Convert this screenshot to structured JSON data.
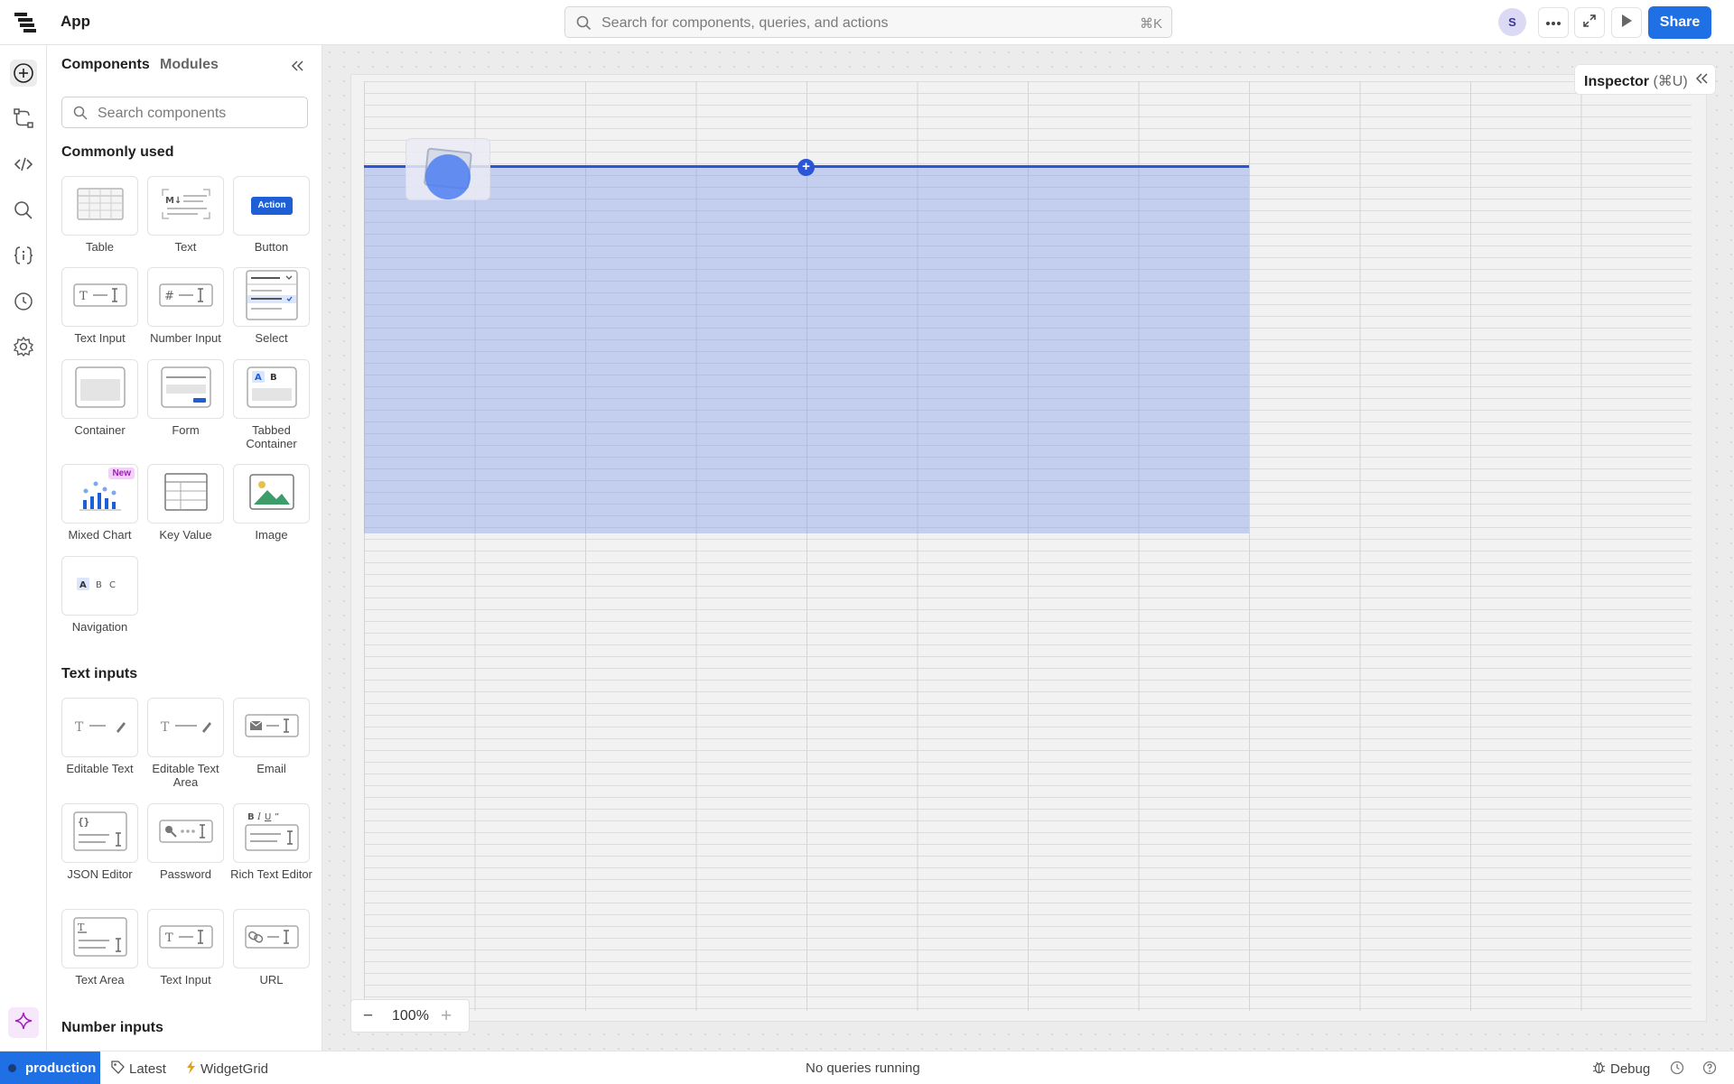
{
  "app": {
    "title": "App"
  },
  "search": {
    "placeholder": "Search for components, queries, and actions",
    "shortcut": "⌘K"
  },
  "user": {
    "initial": "S"
  },
  "toolbar": {
    "share_label": "Share"
  },
  "panel": {
    "tabs": [
      {
        "label": "Components"
      },
      {
        "label": "Modules"
      }
    ],
    "search_placeholder": "Search components",
    "sections": [
      {
        "title": "Commonly used",
        "items": [
          {
            "label": "Table"
          },
          {
            "label": "Text"
          },
          {
            "label": "Button",
            "thumb_text": "Action"
          },
          {
            "label": "Text Input"
          },
          {
            "label": "Number Input"
          },
          {
            "label": "Select"
          },
          {
            "label": "Container"
          },
          {
            "label": "Form"
          },
          {
            "label": "Tabbed Container"
          },
          {
            "label": "Mixed Chart",
            "badge": "New"
          },
          {
            "label": "Key Value"
          },
          {
            "label": "Image"
          },
          {
            "label": "Navigation"
          }
        ]
      },
      {
        "title": "Text inputs",
        "items": [
          {
            "label": "Editable Text"
          },
          {
            "label": "Editable Text Area"
          },
          {
            "label": "Email"
          },
          {
            "label": "JSON Editor"
          },
          {
            "label": "Password"
          },
          {
            "label": "Rich Text Editor"
          },
          {
            "label": "Text Area"
          },
          {
            "label": "Text Input"
          },
          {
            "label": "URL"
          }
        ]
      },
      {
        "title": "Number inputs",
        "items": []
      }
    ]
  },
  "inspector": {
    "label": "Inspector",
    "shortcut": "(⌘U)"
  },
  "zoom": {
    "minus": "−",
    "value": "100%",
    "plus": "+"
  },
  "status": {
    "environment": "production",
    "version": "Latest",
    "branch": "WidgetGrid",
    "queries": "No queries running",
    "debug_label": "Debug"
  },
  "colors": {
    "accent": "#1f6fe5",
    "selection": "#7896eb",
    "insert_line": "#2a55d6"
  }
}
